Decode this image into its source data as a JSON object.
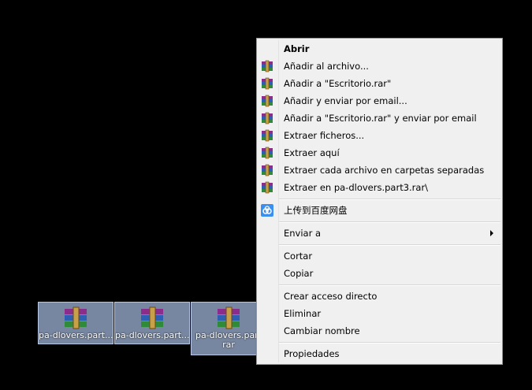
{
  "desktop": {
    "icons": [
      {
        "label": "pa-dlovers.part..."
      },
      {
        "label": "pa-dlovers.part..."
      },
      {
        "label": "pa-dlovers.part rar"
      }
    ]
  },
  "context_menu": {
    "items": [
      {
        "label": "Abrir",
        "bold": true
      },
      {
        "label": "Añadir al archivo...",
        "icon": "winrar-icon"
      },
      {
        "label": "Añadir a \"Escritorio.rar\"",
        "icon": "winrar-icon"
      },
      {
        "label": "Añadir y enviar por email...",
        "icon": "winrar-icon"
      },
      {
        "label": "Añadir a \"Escritorio.rar\" y enviar por email",
        "icon": "winrar-icon"
      },
      {
        "label": "Extraer ficheros...",
        "icon": "winrar-icon"
      },
      {
        "label": "Extraer aquí",
        "icon": "winrar-icon"
      },
      {
        "label": "Extraer cada archivo en carpetas separadas",
        "icon": "winrar-icon"
      },
      {
        "label": "Extraer en pa-dlovers.part3.rar\\",
        "icon": "winrar-icon"
      },
      {
        "label": "上传到百度网盘",
        "icon": "baidu-netdisk-icon"
      },
      {
        "label": "Enviar a",
        "submenu": true
      },
      {
        "label": "Cortar"
      },
      {
        "label": "Copiar"
      },
      {
        "label": "Crear acceso directo"
      },
      {
        "label": "Eliminar"
      },
      {
        "label": "Cambiar nombre"
      },
      {
        "label": "Propiedades"
      }
    ]
  }
}
